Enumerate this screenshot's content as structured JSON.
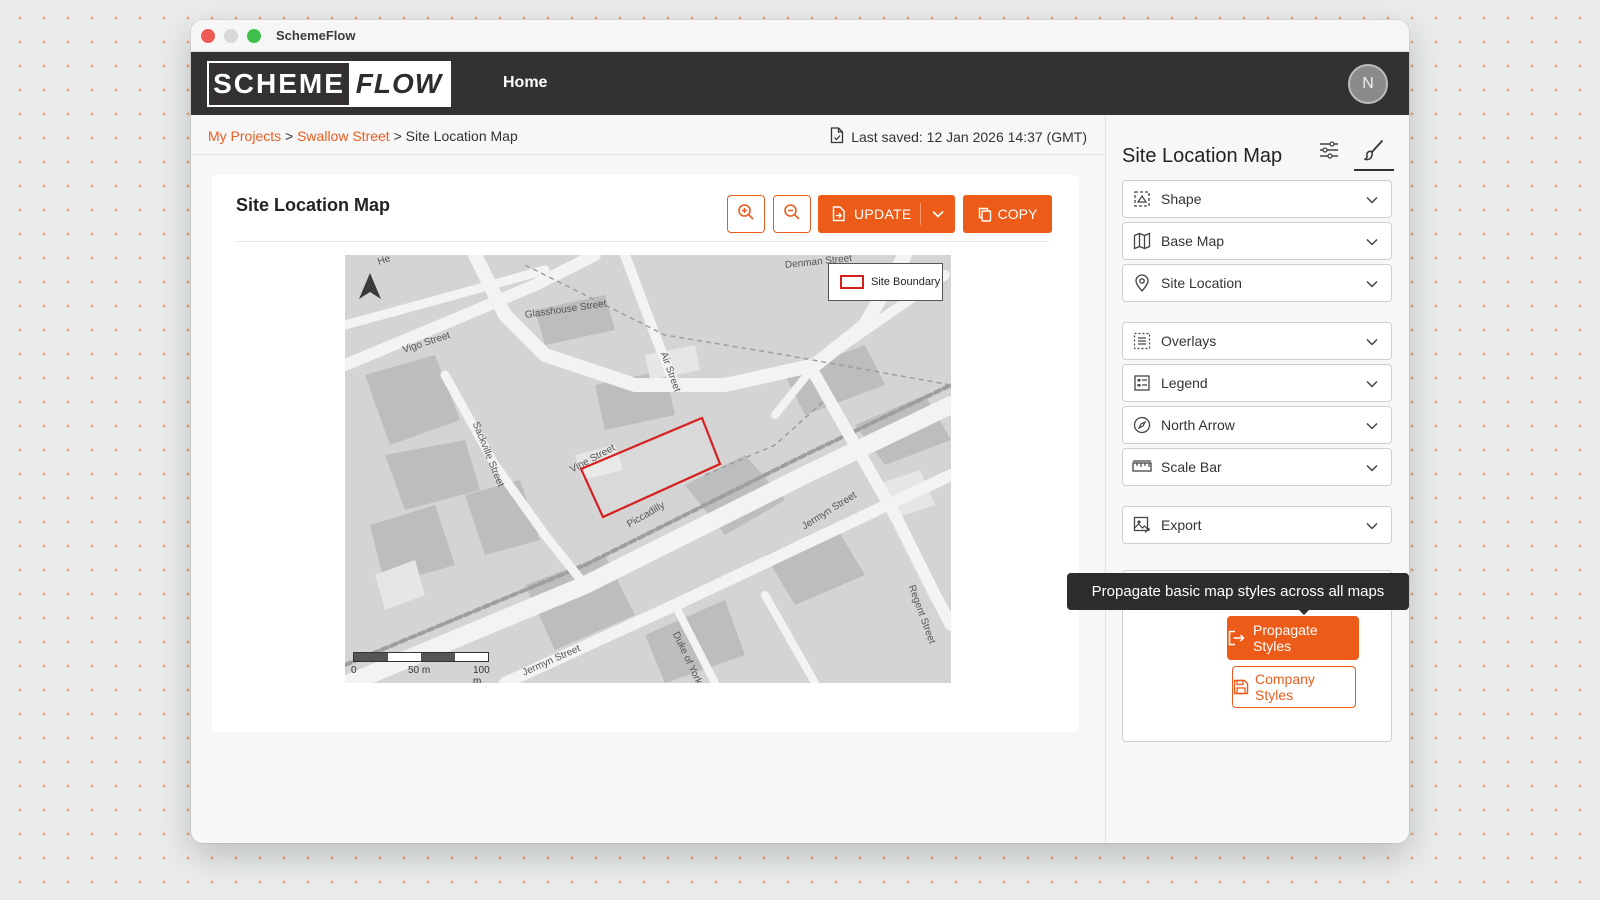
{
  "window": {
    "title": "SchemeFlow"
  },
  "header": {
    "logo_left": "SCHEME",
    "logo_right": "FLOW",
    "nav_home": "Home",
    "avatar_initial": "N"
  },
  "breadcrumb": {
    "items": [
      "My Projects",
      "Swallow Street",
      "Site Location Map"
    ],
    "separator": ">"
  },
  "status": {
    "last_saved": "Last saved: 12 Jan 2026 14:37 (GMT)"
  },
  "main": {
    "title": "Site Location Map",
    "buttons": {
      "update": "UPDATE",
      "copy": "COPY"
    },
    "icons": {
      "zoom_in": "zoom-in-icon",
      "zoom_out": "zoom-out-icon",
      "update": "file-export-icon",
      "copy": "copy-icon",
      "dropdown": "chevron-down-icon"
    }
  },
  "map": {
    "streets": [
      "Glasshouse Street",
      "Denman Street",
      "Vigo Street",
      "Air Street",
      "Sackville Street",
      "Vine Street",
      "Piccadilly",
      "Jermyn Street",
      "Jermyn Street",
      "Duke of York",
      "Regent Street",
      "He"
    ],
    "legend_label": "Site Boundary",
    "scale_labels": [
      "0",
      "50 m",
      "100 m"
    ]
  },
  "panel": {
    "title": "Site Location Map",
    "sections": [
      {
        "label": "Shape",
        "icon": "shape-icon"
      },
      {
        "label": "Base Map",
        "icon": "map-icon"
      },
      {
        "label": "Site Location",
        "icon": "location-pin-icon"
      },
      {
        "label": "Overlays",
        "icon": "overlays-icon"
      },
      {
        "label": "Legend",
        "icon": "legend-icon"
      },
      {
        "label": "North Arrow",
        "icon": "compass-icon"
      },
      {
        "label": "Scale Bar",
        "icon": "ruler-icon"
      },
      {
        "label": "Export",
        "icon": "image-export-icon"
      }
    ],
    "tooltip": "Propagate basic map styles across all maps",
    "buttons": {
      "propagate": "Propagate Styles",
      "company": "Company Styles"
    }
  },
  "colors": {
    "accent": "#ec5b17",
    "header": "#333132",
    "site_boundary": "#d62020"
  }
}
